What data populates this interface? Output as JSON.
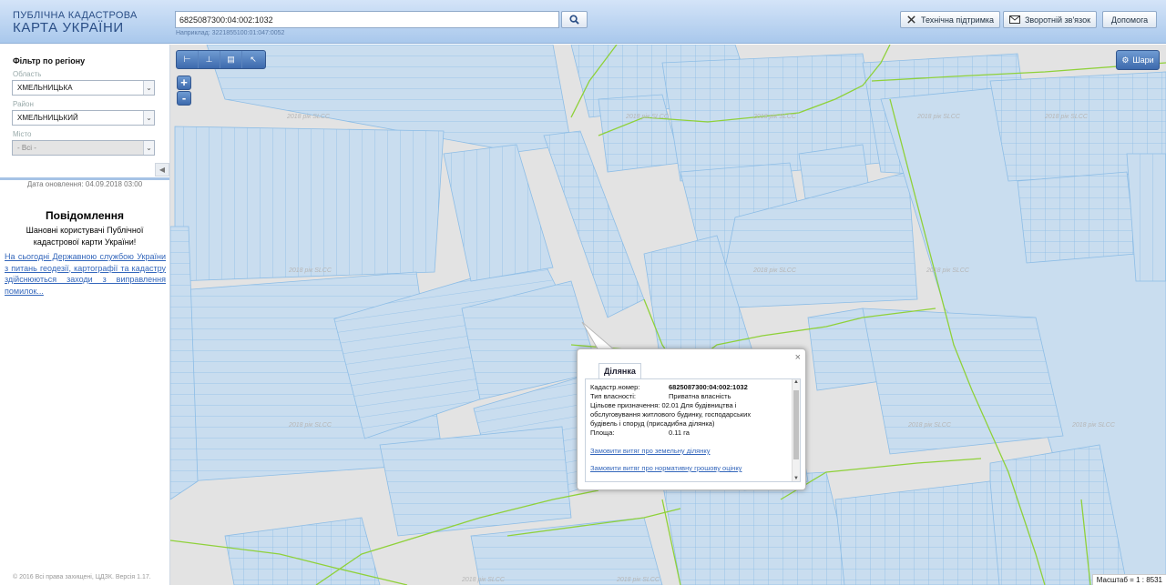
{
  "header": {
    "logo_line1": "ПУБЛІЧНА КАДАСТРОВА",
    "logo_line2": "КАРТА УКРАЇНИ",
    "search_value": "6825087300:04:002:1032",
    "search_hint": "Наприклад: 3221855100:01:047:0052",
    "buttons": {
      "support": "Технічна підтримка",
      "feedback": "Зворотній зв'язок",
      "help": "Допомога"
    }
  },
  "sidebar": {
    "filter_title": "Фільтр по регіону",
    "oblast_label": "Область",
    "oblast_value": "ХМЕЛЬНИЦЬКА",
    "rayon_label": "Район",
    "rayon_value": "ХМЕЛЬНИЦЬКИЙ",
    "city_label": "Місто",
    "city_value": "- Всі -",
    "update_date": "Дата оновлення: 04.09.2018 03:00",
    "notice_title": "Повідомлення",
    "notice_greeting": "Шановні користувачі Публічної кадастрової карти України!",
    "notice_link": "На сьогодні Державною службою України з питань геодезії, картографії та кадастру здійснюються заходи з виправлення помилок...",
    "copyright": "© 2016 Всі права захищені, ЦДЗК. Версія 1.17."
  },
  "map": {
    "zoom_in": "+",
    "zoom_out": "-",
    "layers_label": "Шари",
    "scale_label": "Масштаб = 1 : 8531",
    "watermark": "2018 рік SLCC"
  },
  "popup": {
    "tab": "Ділянка",
    "close": "×",
    "rows": {
      "cadnum_key": "Кадастр.номер:",
      "cadnum_val": "6825087300:04:002:1032",
      "ownership_key": "Тип власності:",
      "ownership_val": "Приватна власність",
      "purpose_key": "Цільове призначення:",
      "purpose_val": "02.01 Для будівництва і обслуговування житлового будинку, господарських будівель і споруд (присадибна ділянка)",
      "area_key": "Площа:",
      "area_val": "0.11 га"
    },
    "link_extract": "Замовити витяг про земельну ділянку",
    "link_valuation": "Замовити витяг про нормативну грошову оцінку"
  },
  "colors": {
    "parcel_fill": "#c9ddef",
    "parcel_stroke": "#8dbde6",
    "boundary": "#8fd13a",
    "map_bg": "#e3e3e3",
    "accent": "#3d6aad"
  }
}
